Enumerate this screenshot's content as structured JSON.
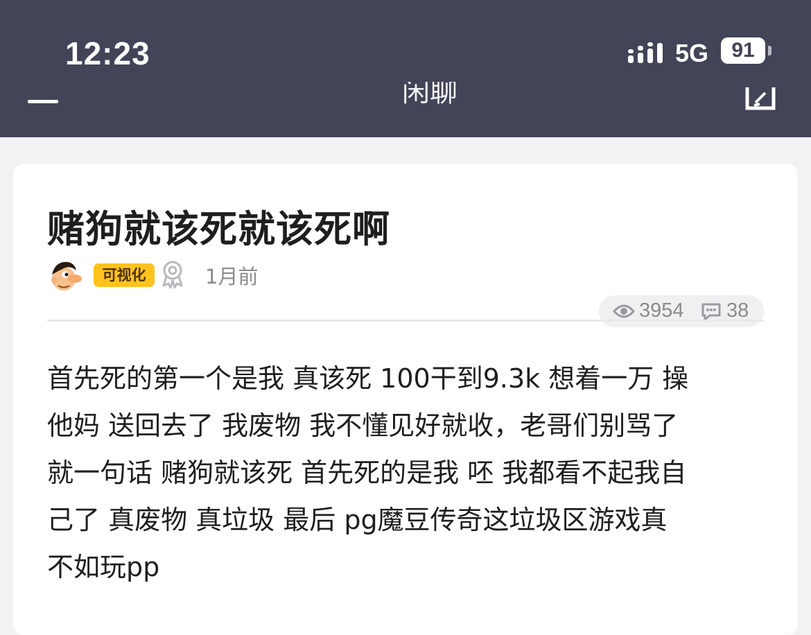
{
  "status_bar": {
    "time": "12:23",
    "network": "5G",
    "battery": "91"
  },
  "nav": {
    "title": "闲聊",
    "menu_icon": "menu-icon",
    "edit_icon": "edit-icon"
  },
  "post": {
    "title": "赌狗就该死就该死啊",
    "author_tag": "可视化",
    "time_ago": "1月前",
    "views": "3954",
    "comments": "38",
    "body_lines": [
      "首先死的第一个是我 真该死 100干到9.3k 想着一万 操",
      "他妈 送回去了 我废物 我不懂见好就收，老哥们别骂了",
      "就一句话 赌狗就该死 首先死的是我 呸 我都看不起我自",
      "己了 真废物 真垃圾   最后 pg魔豆传奇这垃圾区游戏真",
      "不如玩pp"
    ]
  },
  "colors": {
    "header_bg": "#424457",
    "tag_bg": "#ffc21e",
    "muted_text": "#8b8b8b"
  }
}
